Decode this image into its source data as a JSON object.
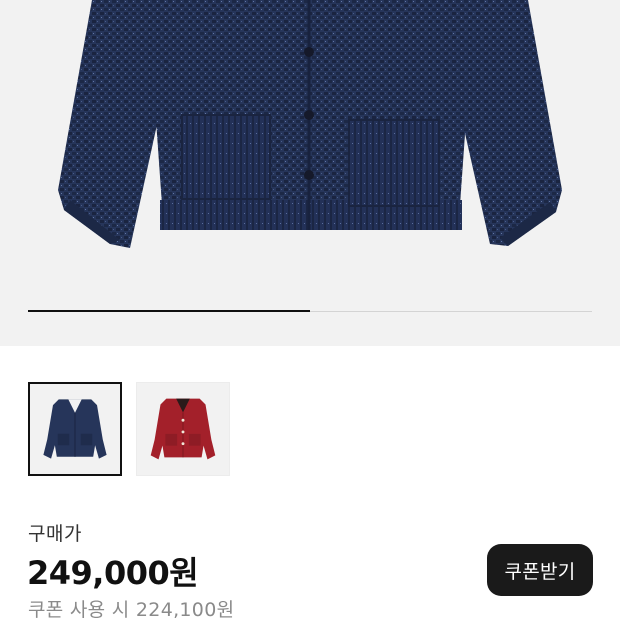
{
  "hero": {
    "image_name": "navy tweed jacket",
    "background_color": "#f2f2f2",
    "carousel_progress": 0.5
  },
  "thumbnails": [
    {
      "name": "navy",
      "color": "#26355a",
      "selected": true
    },
    {
      "name": "red",
      "color": "#a3202a",
      "selected": false
    }
  ],
  "price": {
    "label": "구매가",
    "value": "249,000원",
    "coupon_text": "쿠폰 사용 시 224,100원"
  },
  "coupon_button": {
    "label": "쿠폰받기"
  },
  "colors": {
    "accent": "#1a1a1a",
    "muted": "#8a8a8a"
  }
}
